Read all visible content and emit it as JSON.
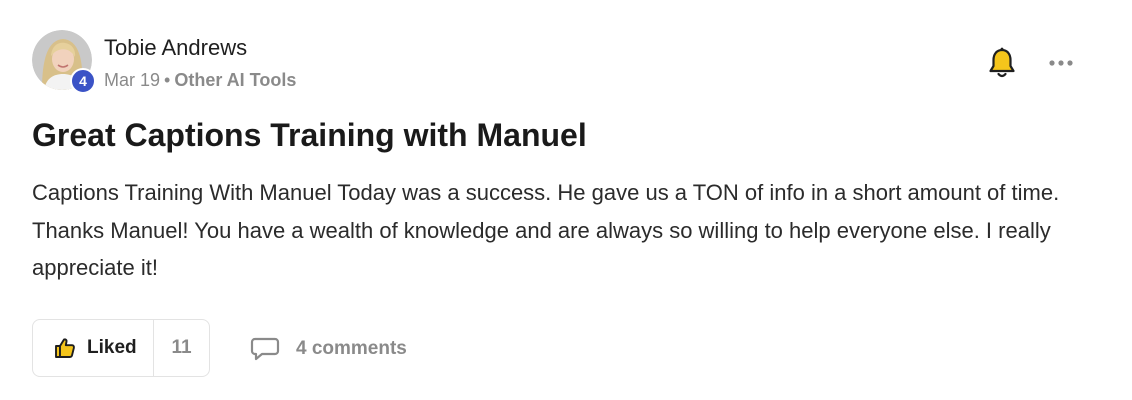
{
  "author": {
    "name": "Tobie Andrews",
    "level": "4"
  },
  "meta": {
    "date": "Mar 19",
    "separator": "•",
    "category": "Other AI Tools"
  },
  "post": {
    "title": "Great Captions Training with Manuel",
    "body": "Captions Training With Manuel Today was a success. He gave us a TON of info in a short amount of time. Thanks Manuel! You have a wealth of knowledge and are always so willing to help everyone else. I really appreciate it!"
  },
  "actions": {
    "like_label": "Liked",
    "like_count": "11",
    "comments_label": "4 comments"
  },
  "icons": {
    "bell": "bell-icon",
    "more": "more-horizontal-icon",
    "thumbs_up": "thumbs-up-icon",
    "comment": "comment-bubble-icon"
  },
  "colors": {
    "level_badge": "#3b53c6",
    "bell_fill": "#f5c51b",
    "muted_text": "#8a8a8a",
    "title_text": "#1a1a1a"
  }
}
